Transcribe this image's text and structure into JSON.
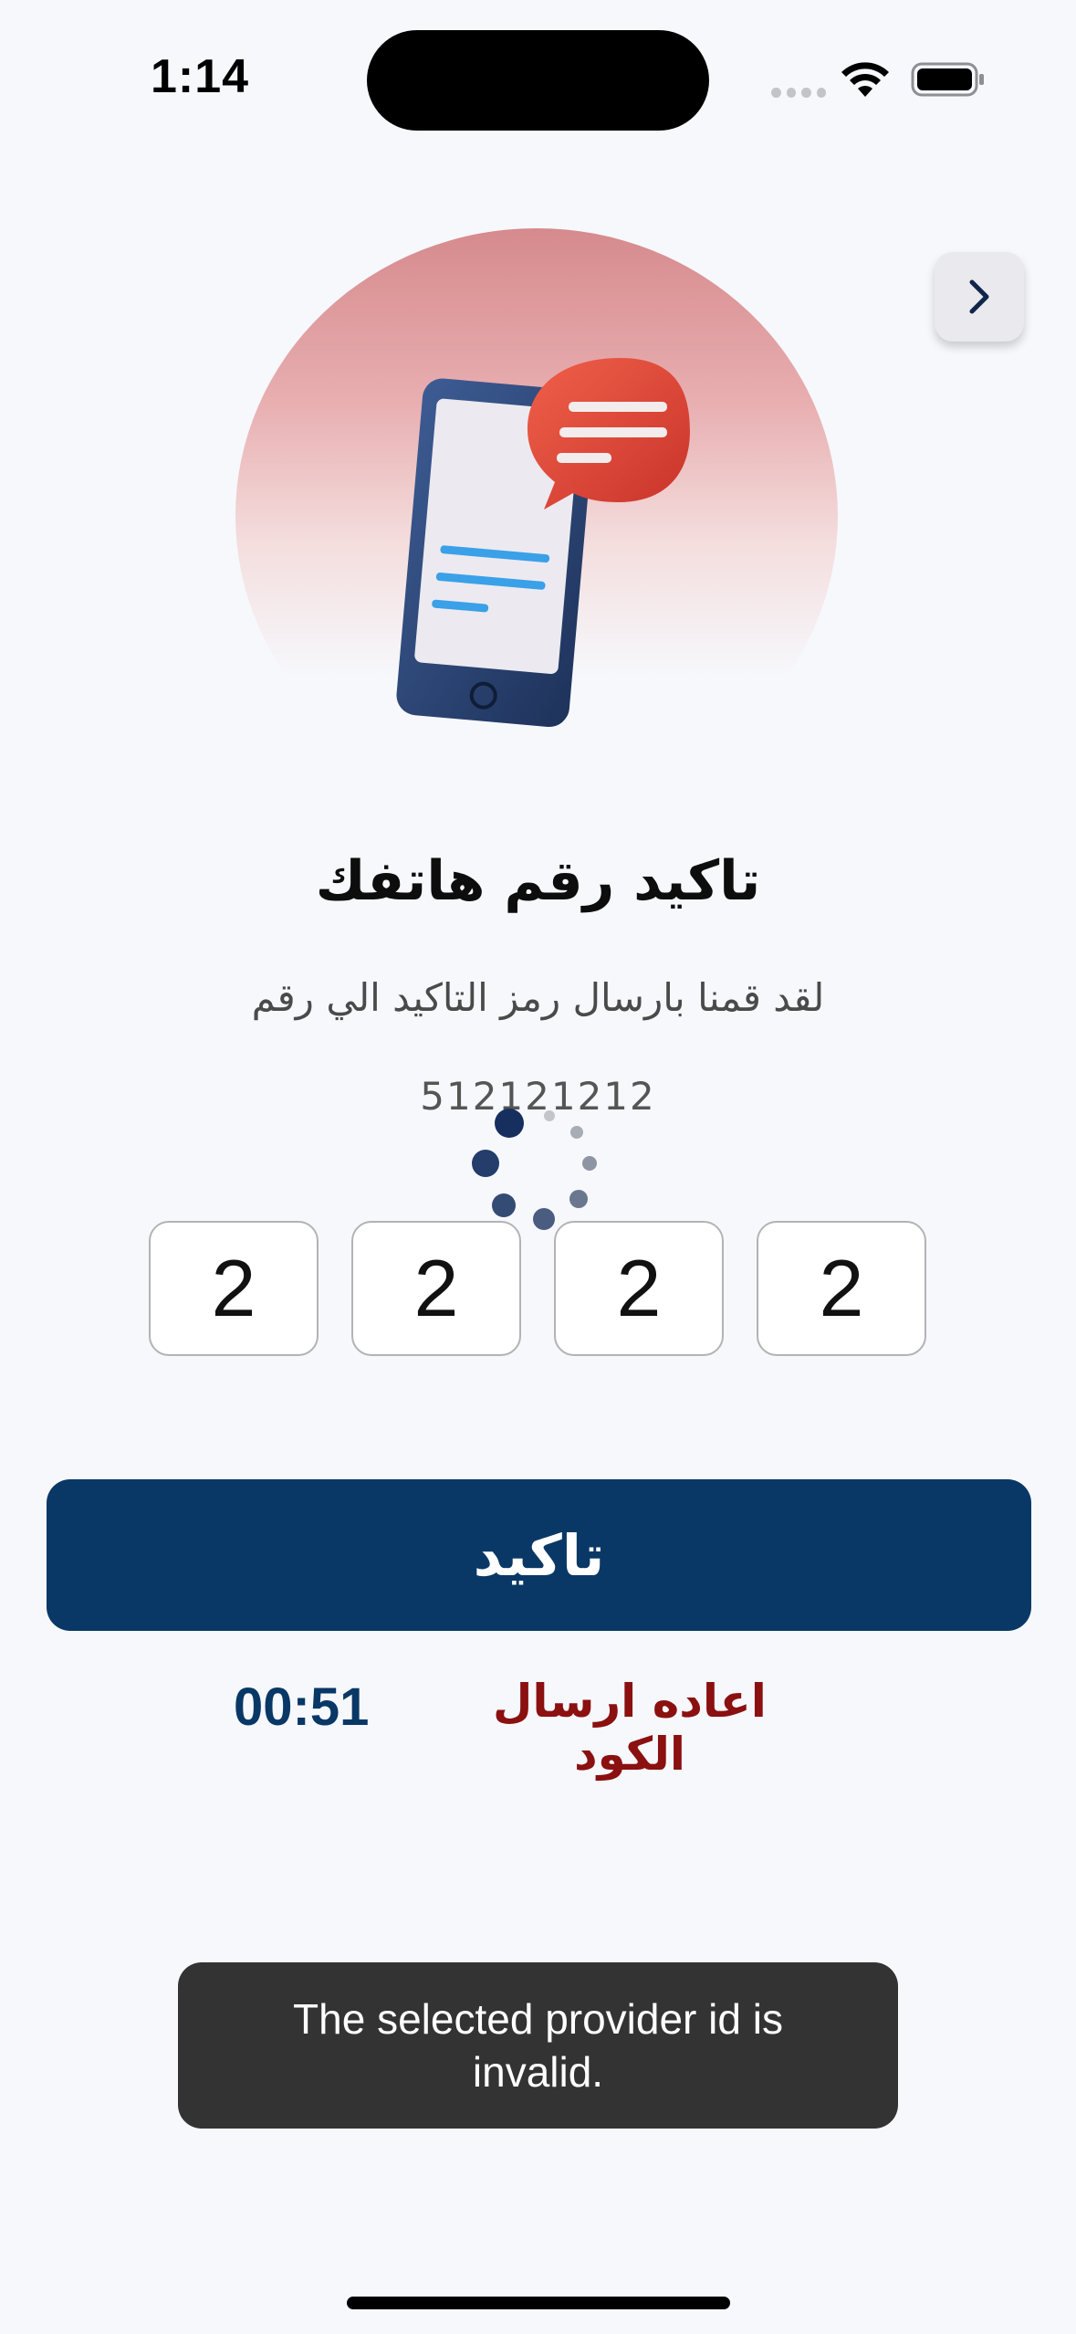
{
  "status_bar": {
    "time": "1:14"
  },
  "header": {
    "back_icon": "chevron-right-icon"
  },
  "hero": {
    "illustration": "phone-with-chat-bubble",
    "colors": {
      "circle": "#e8aeb0",
      "bubble": "#e0483a",
      "phone_body": "#2c4677",
      "lines": "#3aa0e8"
    }
  },
  "verify": {
    "title": "تاكيد رقم هاتفك",
    "subtitle": "لقد قمنا بارسال رمز التاكيد الي رقم",
    "phone_number": "512121212"
  },
  "otp": {
    "digits": [
      "2",
      "2",
      "2",
      "2"
    ]
  },
  "actions": {
    "confirm_label": "تاكيد",
    "resend_label": "اعاده ارسال الكود",
    "countdown": "00:51"
  },
  "toast": {
    "message": "The selected provider id is invalid."
  },
  "colors": {
    "primary": "#093866",
    "resend": "#8b1010",
    "background": "#f6f8fc",
    "toast_bg": "#333333"
  }
}
